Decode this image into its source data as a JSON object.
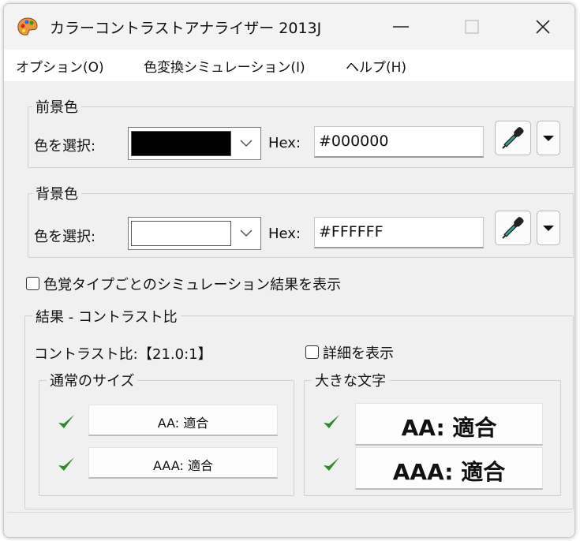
{
  "window": {
    "title": "カラーコントラストアナライザー 2013J",
    "icons": {
      "app": "palette-icon",
      "minimize": "minimize-icon",
      "maximize": "maximize-icon",
      "close": "close-icon"
    }
  },
  "menu": [
    "オプション(O)",
    "色変換シミュレーション(I)",
    "ヘルプ(H)"
  ],
  "foreground": {
    "legend": "前景色",
    "select_label": "色を選択:",
    "swatch_color": "#000000",
    "hex_label": "Hex:",
    "hex_value": "#000000"
  },
  "background": {
    "legend": "背景色",
    "select_label": "色を選択:",
    "swatch_color": "#FFFFFF",
    "hex_label": "Hex:",
    "hex_value": "#FFFFFF"
  },
  "simulation_checkbox": {
    "label": "色覚タイプごとのシミュレーション結果を表示",
    "checked": false
  },
  "results": {
    "legend": "結果 - コントラスト比",
    "ratio_label": "コントラスト比:",
    "ratio_value": "【21.0:1】",
    "detail_checkbox": {
      "label": "詳細を表示",
      "checked": false
    },
    "normal": {
      "legend": "通常のサイズ",
      "aa": "AA: 適合",
      "aaa": "AAA: 適合"
    },
    "large": {
      "legend": "大きな文字",
      "aa": "AA: 適合",
      "aaa": "AAA: 適合"
    }
  },
  "colors": {
    "accent_check": "#2f8a2f",
    "dropper_tip": "#1a9a8a"
  }
}
